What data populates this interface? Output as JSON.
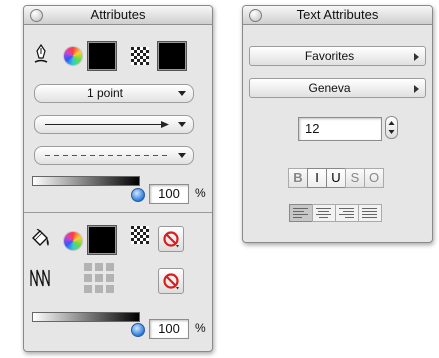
{
  "attributes_palette": {
    "title": "Attributes",
    "stroke": {
      "line_width_value": "1 point",
      "opacity_value": "100",
      "opacity_percent": 1.0,
      "unit": "%"
    },
    "fill": {
      "opacity_value": "100",
      "opacity_percent": 1.0,
      "unit": "%"
    }
  },
  "text_attributes_palette": {
    "title": "Text Attributes",
    "favorites_label": "Favorites",
    "font_value": "Geneva",
    "font_size_value": "12",
    "style_buttons": [
      "B",
      "I",
      "U",
      "S",
      "O"
    ]
  },
  "colors": {
    "stroke_color": "#000000",
    "fill_color": "#000000",
    "slider_knob": "#2a7cdc",
    "no_paint_red": "#d42020"
  },
  "icons": {
    "stroke_tool": "fountain-pen-icon",
    "fill_tool": "paint-bucket-icon",
    "color_picker": "color-wheel-icon",
    "pattern": "checker-pattern-icon",
    "shadow": "zigzag-shadow-icon",
    "grid": "grid-dots-icon",
    "no_paint": "no-paint-icon"
  }
}
